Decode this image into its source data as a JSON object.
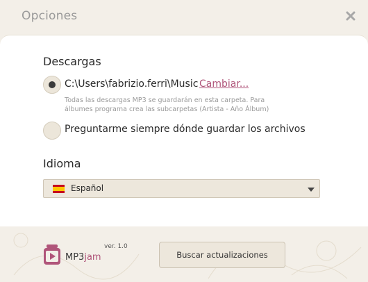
{
  "window": {
    "title": "Opciones"
  },
  "downloads": {
    "section_title": "Descargas",
    "path": "C:\\Users\\fabrizio.ferri\\Music",
    "change_label": "Cambiar...",
    "hint": "Todas las descargas MP3 se guardarán en esta carpeta. Para álbumes programa crea las subcarpetas (Artista - Año Álbum)",
    "ask_label": "Preguntarme siempre dónde guardar los archivos",
    "selected_option": "path"
  },
  "language": {
    "section_title": "Idioma",
    "selected": "Español",
    "flag_icon": "spain-flag-icon"
  },
  "footer": {
    "brand_prefix": "MP3",
    "brand_suffix": "jam",
    "version": "ver. 1.0",
    "update_button_label": "Buscar actualizaciones"
  },
  "colors": {
    "accent": "#b0557a",
    "background": "#f3efe8",
    "panel": "#ffffff"
  }
}
